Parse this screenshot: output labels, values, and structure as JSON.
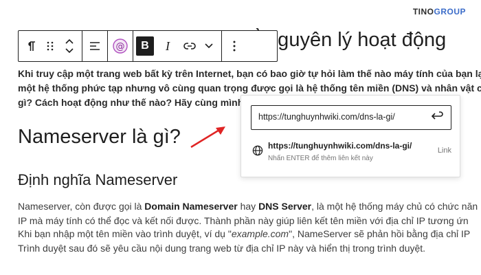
{
  "brand": {
    "part1": "TINO",
    "part2": "GROUP"
  },
  "toolbar": {
    "paragraph_icon": "pilcrow-icon",
    "bold_label": "B",
    "italic_label": "I"
  },
  "post": {
    "title_fragment": "̀ nguyên lý hoạt động",
    "intro_lines": [
      "Khi truy cập một trang web bất kỳ trên Internet, bạn có bao giờ tự hỏi làm thế nào máy tính của bạn lại tì",
      "một hệ thống phức tạp nhưng vô cùng quan trọng được gọi là hệ thống tên miền (DNS) và nhân vật chính",
      "gì? Cách hoạt động như thế nào? Hãy cùng mình t"
    ],
    "h2": "Nameserver là gì?",
    "h3": "Định nghĩa Nameserver",
    "p1_line1_a": "Nameserver, còn được gọi là ",
    "p1_line1_b": "Domain Nameserver",
    "p1_line1_c": " hay ",
    "p1_line1_d": "DNS Server",
    "p1_line1_e": ", là một hệ thống máy chủ có chức năn",
    "p1_line2": "IP mà máy tính có thể đọc và kết nối được. Thành phần này giúp liên kết tên miền với địa chỉ IP tương ứn",
    "p2_line1_a": "Khi bạn nhập một tên miền vào trình duyệt, ví dụ \"",
    "p2_line1_b": "example.com",
    "p2_line1_c": "\", NameServer sẽ phản hồi bằng địa chỉ IP",
    "p2_line2": "Trình duyệt sau đó sẽ yêu cầu nội dung trang web từ địa chỉ IP này và hiển thị trong trình duyệt."
  },
  "link_popover": {
    "url_value": "https://tunghuynhwiki.com/dns-la-gi/",
    "suggestion_url": "https://tunghuynhwiki.com/dns-la-gi/",
    "suggestion_hint": "Nhấn ENTER để thêm liên kết này",
    "suggestion_type": "Link"
  },
  "colors": {
    "annotation_arrow": "#e02424",
    "brand_accent": "#3b6cc9"
  }
}
